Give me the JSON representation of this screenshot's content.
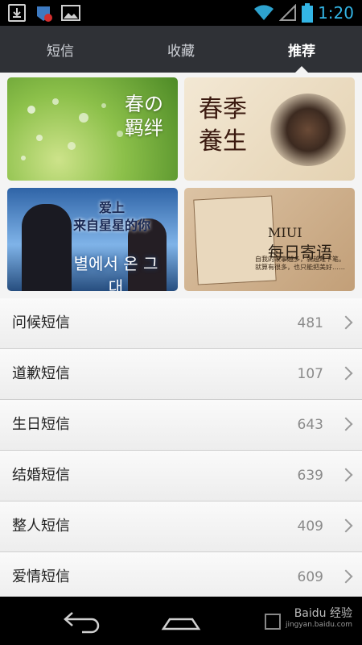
{
  "status_bar": {
    "time": "1:20"
  },
  "tabs": [
    {
      "label": "短信",
      "active": false
    },
    {
      "label": "收藏",
      "active": false
    },
    {
      "label": "推荐",
      "active": true
    }
  ],
  "banners": [
    {
      "title": "春の羁绊"
    },
    {
      "title": "春季養生"
    },
    {
      "title": "来自星星的你",
      "top": "爱上",
      "korean": "별에서 온 그대"
    },
    {
      "title": "每日寄语",
      "brand": "MIUI",
      "note": "自我的故事越多，就越难下笔。就算有很多，也只能把美好……"
    }
  ],
  "categories": [
    {
      "label": "问候短信",
      "count": "481"
    },
    {
      "label": "道歉短信",
      "count": "107"
    },
    {
      "label": "生日短信",
      "count": "643"
    },
    {
      "label": "结婚短信",
      "count": "639"
    },
    {
      "label": "整人短信",
      "count": "409"
    },
    {
      "label": "爱情短信",
      "count": "609"
    }
  ],
  "watermark": {
    "text": "Baidu 经验",
    "url": "jingyan.baidu.com"
  },
  "colors": {
    "accent": "#33b5e5",
    "tab_bg": "#2f3136",
    "list_bg": "#f4f4f4"
  },
  "icons": [
    "download-icon",
    "notification-icon",
    "image-icon",
    "wifi-icon",
    "signal-icon",
    "battery-icon",
    "back-icon",
    "home-icon",
    "recent-apps-icon",
    "chevron-right-icon"
  ]
}
